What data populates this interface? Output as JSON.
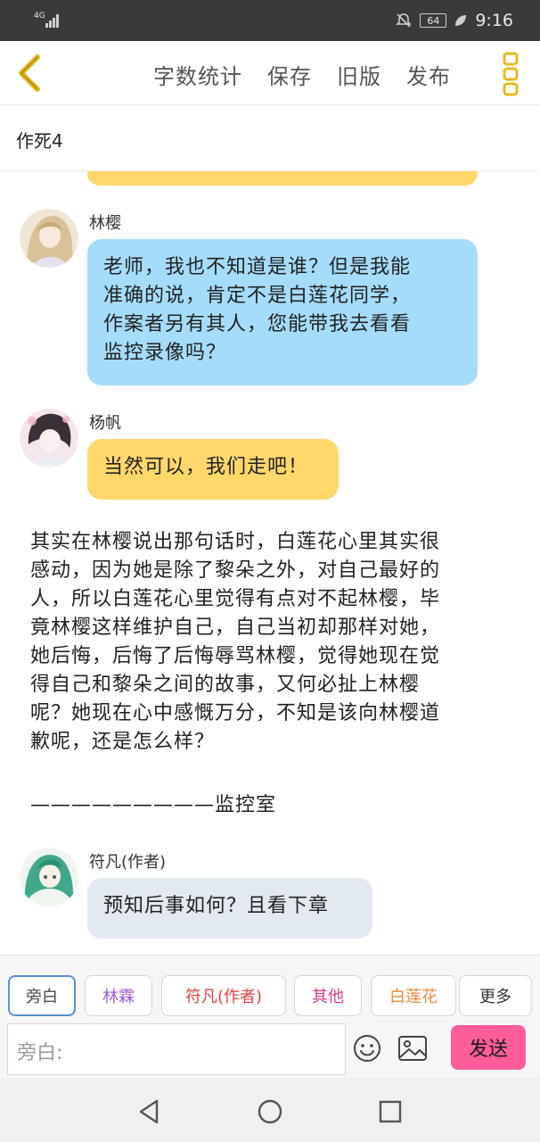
{
  "status_bar": {
    "network": "4G",
    "battery": "64",
    "time": "9:16"
  },
  "toolbar": {
    "back_icon": "chevron-left-icon",
    "actions": [
      "字数统计",
      "保存",
      "旧版",
      "发布"
    ],
    "more_icon": "vertical-dots-icon",
    "accent_color": "#e8b820"
  },
  "chapter": {
    "title": "作死4"
  },
  "messages": [
    {
      "speaker": "林樱",
      "text_lines": [
        "老师，我也不知道是谁？但是我能",
        "准确的说，肯定不是白莲花同学，",
        "作案者另有其人，您能带我去看看",
        "监控录像吗？"
      ],
      "bubble_color": "#a5dcfa"
    },
    {
      "speaker": "杨帆",
      "text_lines": [
        "当然可以，我们走吧！"
      ],
      "bubble_color": "#ffd76a"
    },
    {
      "narration_lines": [
        "其实在林樱说出那句话时，白莲花心里其实很",
        "感动，因为她是除了黎朵之外，对自己最好的",
        "人，所以白莲花心里觉得有点对不起林樱，毕",
        "竟林樱这样维护自己，自己当初却那样对她，",
        "她后悔，后悔了后悔辱骂林樱，觉得她现在觉",
        "得自己和黎朵之间的故事，又何必扯上林樱",
        "呢？她现在心中感慨万分，不知是该向林樱道",
        "歉呢，还是怎么样？"
      ]
    },
    {
      "divider_text": "—————————监控室"
    },
    {
      "speaker": "符凡(作者)",
      "text_lines": [
        "预知后事如何？且看下章"
      ],
      "bubble_color": "#e3e9f0"
    }
  ],
  "roles": [
    {
      "label": "旁白",
      "color": "#4a4a4a"
    },
    {
      "label": "林霖",
      "color": "#a05ad0"
    },
    {
      "label": "符凡(作者)",
      "color": "#e0453a"
    },
    {
      "label": "其他",
      "color": "#d83a8a"
    },
    {
      "label": "白莲花",
      "color": "#f08a3a"
    },
    {
      "label": "更多",
      "color": "#333333"
    }
  ],
  "composer": {
    "placeholder": "旁白:",
    "emoji_icon": "smiley-icon",
    "image_icon": "image-icon",
    "send_label": "发送"
  },
  "nav_bar": {
    "back_icon": "triangle-back-icon",
    "home_icon": "circle-home-icon",
    "recent_icon": "square-recent-icon"
  }
}
